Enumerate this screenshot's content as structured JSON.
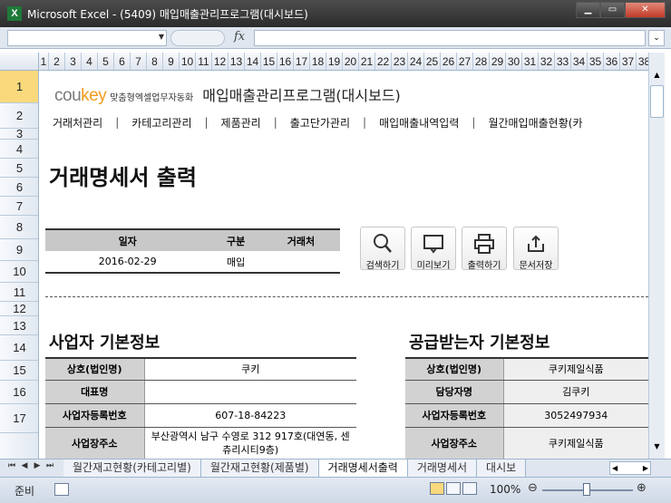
{
  "window": {
    "title": "Microsoft Excel - (5409) 매입매출관리프로그램(대시보드)",
    "app_letter": "X"
  },
  "columns": [
    "1",
    "2",
    "3",
    "4",
    "5",
    "6",
    "7",
    "8",
    "9",
    "10",
    "11",
    "12",
    "13",
    "14",
    "15",
    "16",
    "17",
    "18",
    "19",
    "20",
    "21",
    "22",
    "23",
    "24",
    "25",
    "26",
    "27",
    "28",
    "29",
    "30",
    "31",
    "32",
    "33",
    "34",
    "35",
    "36",
    "37",
    "38"
  ],
  "rows": [
    "1",
    "2",
    "3",
    "4",
    "5",
    "6",
    "7",
    "8",
    "9",
    "10",
    "11",
    "12",
    "13",
    "14",
    "15",
    "16",
    "17"
  ],
  "brand": {
    "logo_a": "cou",
    "logo_b": "key",
    "tagline": "맞춤형엑셀업무자동화",
    "program_title": "매입매출관리프로그램(대시보드)"
  },
  "nav": [
    "거래처관리",
    "카테고리관리",
    "제품관리",
    "출고단가관리",
    "매입매출내역입력",
    "월간매입매출현황(카"
  ],
  "section_title": "거래명세서 출력",
  "transaction": {
    "headers": [
      "일자",
      "구분",
      "거래처"
    ],
    "row": [
      "2016-02-29",
      "매입",
      ""
    ]
  },
  "buttons": [
    {
      "label": "검색하기",
      "icon": "search-icon"
    },
    {
      "label": "미리보기",
      "icon": "monitor-icon"
    },
    {
      "label": "출력하기",
      "icon": "printer-icon"
    },
    {
      "label": "문서저장",
      "icon": "upload-icon"
    }
  ],
  "business": {
    "title": "사업자 기본정보",
    "rows": [
      [
        "상호(법인명)",
        "쿠키"
      ],
      [
        "대표명",
        ""
      ],
      [
        "사업자등록번호",
        "607-18-84223"
      ],
      [
        "사업장주소",
        "부산광역시 남구 수영로 312 917호(대연동, 센츄리시티9층)"
      ]
    ]
  },
  "supplier": {
    "title": "공급받는자 기본정보",
    "rows": [
      [
        "상호(법인명)",
        "쿠키제일식품"
      ],
      [
        "담당자명",
        "김쿠키"
      ],
      [
        "사업자등록번호",
        "3052497934"
      ],
      [
        "사업장주소",
        "쿠키제일식품"
      ]
    ]
  },
  "sheet_tabs": [
    "월간재고현황(카테고리별)",
    "월간재고현황(제품별)",
    "거래명세서출력",
    "거래명세서",
    "대시보"
  ],
  "active_tab": "거래명세서출력",
  "status": {
    "ready": "준비",
    "zoom": "100%"
  }
}
